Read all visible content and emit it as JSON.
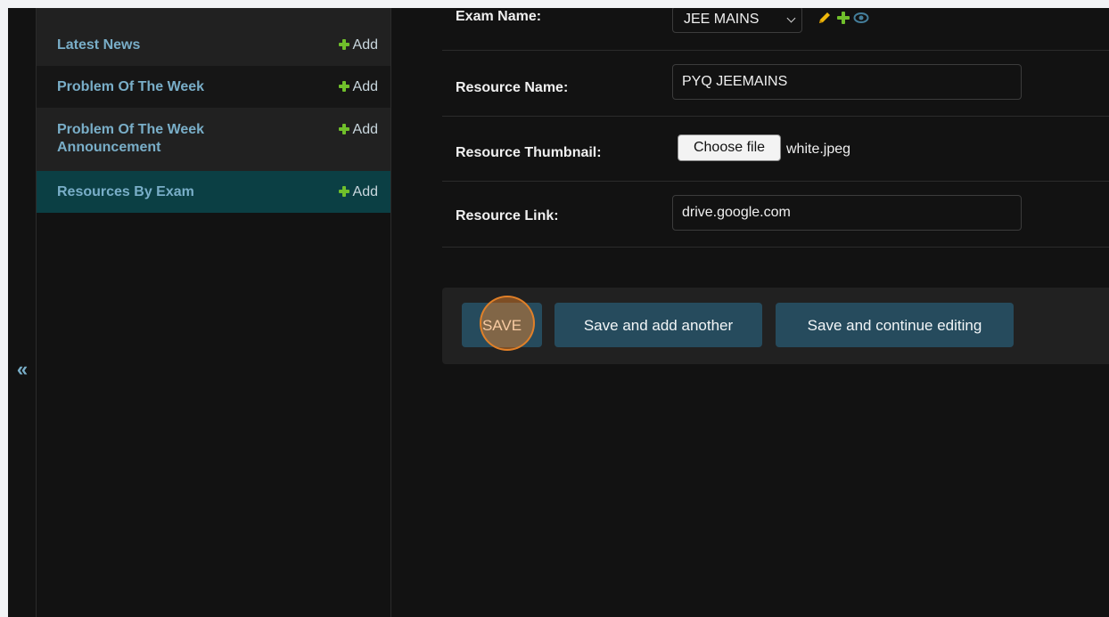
{
  "sidebar": {
    "collapse_icon_glyph": "«",
    "items": [
      {
        "label": "Latest News",
        "add_label": "Add"
      },
      {
        "label": "Problem Of The Week",
        "add_label": "Add"
      },
      {
        "label": "Problem Of The Week Announcement",
        "add_label": "Add"
      },
      {
        "label": "Resources By Exam",
        "add_label": "Add",
        "active": true
      }
    ]
  },
  "form": {
    "exam_name": {
      "label": "Exam Name:",
      "selected": "JEE MAINS",
      "actions": [
        "pencil-icon",
        "plus-icon",
        "eye-icon"
      ]
    },
    "resource_name": {
      "label": "Resource Name:",
      "value": "PYQ JEEMAINS"
    },
    "resource_thumbnail": {
      "label": "Resource Thumbnail:",
      "button_label": "Choose file",
      "file_name": "white.jpeg"
    },
    "resource_link": {
      "label": "Resource Link:",
      "value": "drive.google.com"
    }
  },
  "submit": {
    "save_label": "SAVE",
    "save_add_label": "Save and add another",
    "save_continue_label": "Save and continue editing"
  },
  "colors": {
    "background": "#121212",
    "link": "#79aec8",
    "active_row": "#0b3f44",
    "button": "#264b5d",
    "add_icon": "#70bf2b",
    "edit_icon": "#efb80b",
    "view_icon": "#447e9b",
    "click_highlight": "#f08c28"
  }
}
